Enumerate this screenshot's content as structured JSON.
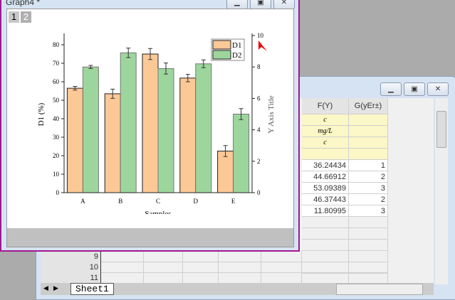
{
  "graph_window": {
    "title": "Graph4 *",
    "layer_tabs": [
      "1",
      "2"
    ]
  },
  "chart_data": {
    "type": "bar",
    "categories": [
      "A",
      "B",
      "C",
      "D",
      "E"
    ],
    "xlabel": "Samples",
    "ylabel": "D1 (%)",
    "y2label": "Y Axis Title",
    "ylim": [
      0,
      85
    ],
    "y2lim": [
      0,
      10
    ],
    "yticks": [
      0,
      10,
      20,
      30,
      40,
      50,
      60,
      70,
      80
    ],
    "y2ticks": [
      0,
      2,
      4,
      6,
      8,
      10
    ],
    "series": [
      {
        "name": "D1",
        "axis": "left",
        "color": "#fcc896",
        "values": [
          56.5,
          53.5,
          75,
          62,
          22.5
        ],
        "errors": [
          1,
          2.5,
          3,
          2,
          3
        ]
      },
      {
        "name": "D2",
        "axis": "right",
        "color": "#9dd69c",
        "values": [
          8.0,
          8.9,
          7.9,
          8.2,
          5.0
        ],
        "errors": [
          0.1,
          0.3,
          0.35,
          0.25,
          0.35
        ]
      }
    ],
    "legend": "top-right"
  },
  "worksheet": {
    "columns": [
      "F(Y)",
      "G(yEr±)"
    ],
    "meta_rows": [
      [
        "c",
        ""
      ],
      [
        "mg/L",
        ""
      ],
      [
        "c",
        ""
      ],
      [
        "",
        ""
      ]
    ],
    "rows": [
      [
        "36.24434",
        "1"
      ],
      [
        "44.66912",
        "2"
      ],
      [
        "53.09389",
        "3"
      ],
      [
        "46.37443",
        "2"
      ],
      [
        "11.80995",
        "3"
      ]
    ],
    "row_numbers": [
      "9",
      "10",
      "11"
    ],
    "sheet_tab": "Sheet1"
  }
}
